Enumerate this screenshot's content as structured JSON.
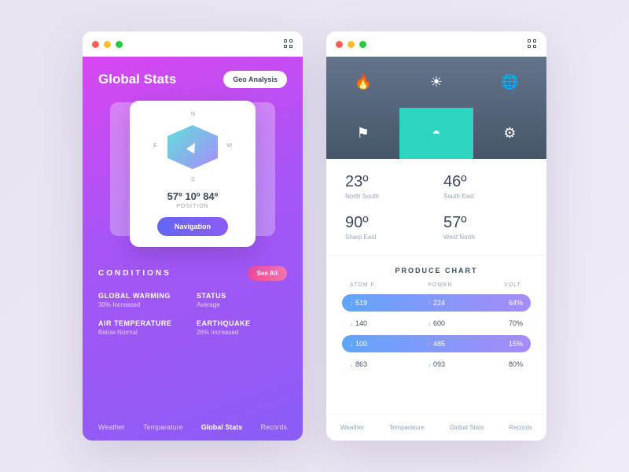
{
  "left": {
    "title": "Global Stats",
    "geo_btn": "Geo Analysis",
    "compass": {
      "n": "N",
      "s": "S",
      "e": "E",
      "w": "W",
      "coords": "57º 10º 84º",
      "label": "POSITION",
      "nav_btn": "Navigation"
    },
    "conditions": {
      "title": "CONDITIONS",
      "see_all": "See All",
      "items": [
        {
          "name": "GLOBAL WARMING",
          "val": "30% Increased"
        },
        {
          "name": "STATUS",
          "val": "Average"
        },
        {
          "name": "AIR TEMPERATURE",
          "val": "Below Normal"
        },
        {
          "name": "EARTHQUAKE",
          "val": "26% Increased"
        }
      ]
    },
    "tabs": [
      "Weather",
      "Temparature",
      "Global Stats",
      "Records"
    ],
    "active_tab": 2
  },
  "right": {
    "icons": [
      "flame-icon",
      "sun-icon",
      "globe-icon",
      "flag-icon",
      "sunset-icon",
      "gear-icon"
    ],
    "active_icon": 4,
    "stats": [
      {
        "deg": "23º",
        "loc": "North South"
      },
      {
        "deg": "46º",
        "loc": "South East"
      },
      {
        "deg": "90º",
        "loc": "Sharp East"
      },
      {
        "deg": "57º",
        "loc": "West North"
      }
    ],
    "produce": {
      "title": "PRODUCE CHART",
      "headers": [
        "ATOM F.",
        "POWER",
        "VOLT."
      ],
      "rows": [
        {
          "hl": true,
          "atom": {
            "dir": "dn",
            "v": "519"
          },
          "power": {
            "dir": "up",
            "v": "224"
          },
          "volt": "64%"
        },
        {
          "hl": false,
          "atom": {
            "dir": "dn",
            "v": "140"
          },
          "power": {
            "dir": "dn",
            "v": "600"
          },
          "volt": "70%"
        },
        {
          "hl": true,
          "atom": {
            "dir": "dn",
            "v": "100"
          },
          "power": {
            "dir": "up",
            "v": "485"
          },
          "volt": "15%"
        },
        {
          "hl": false,
          "atom": {
            "dir": "dn",
            "v": "863"
          },
          "power": {
            "dir": "dn",
            "v": "093"
          },
          "volt": "80%"
        }
      ]
    },
    "tabs": [
      "Weather",
      "Temparature",
      "Global Stats",
      "Records"
    ]
  }
}
